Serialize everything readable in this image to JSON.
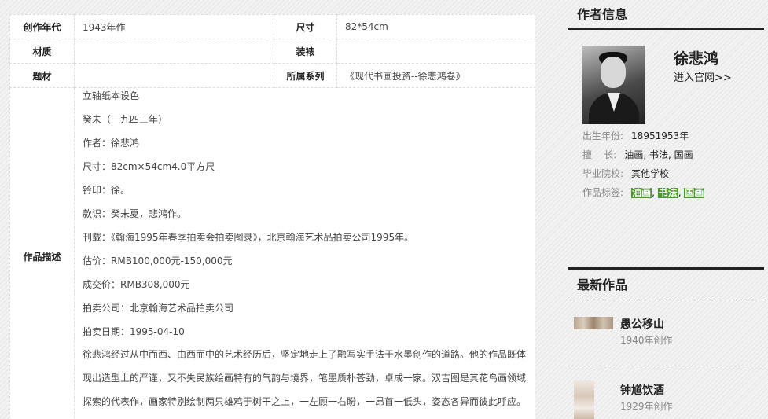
{
  "table": {
    "row1": {
      "label_year": "创作年代",
      "year": "1943年作",
      "label_size": "尺寸",
      "size": "82*54cm"
    },
    "row2": {
      "label_material": "材质",
      "material": "",
      "label_mount": "装裱",
      "mount": ""
    },
    "row3": {
      "label_subject": "题材",
      "subject": "",
      "label_series": "所属系列",
      "series": "《现代书画投资--徐悲鸿卷》"
    },
    "desc_label": "作品描述",
    "desc_lines": [
      "立轴纸本设色",
      "癸未（一九四三年）",
      "作者：徐悲鸿",
      "尺寸：82cm×54cm4.0平方尺",
      "钤印：徐。",
      "款识：癸未夏，悲鸿作。",
      "刊载：《翰海1995年春季拍卖会拍卖图录》，北京翰海艺术品拍卖公司1995年。",
      "估价：RMB100,000元-150,000元",
      "成交价：RMB308,000元",
      "拍卖公司：北京翰海艺术品拍卖公司",
      "拍卖日期：1995-04-10"
    ],
    "desc_para_lines": [
      "徐悲鸿经过从中而西、由西而中的艺术经历后，坚定地走上了融写实手法于水墨创作的道路。他的作品既体",
      "现出造型上的严谨，又不失民族绘画特有的气韵与境界，笔墨质朴苍劲，卓成一家。双吉图是其花鸟画领域",
      "探索的代表作，画家特别绘制两只雄鸡于树干之上，一左顾一右盼，一昂首一低头，姿态各异而彼此呼应。"
    ]
  },
  "author": {
    "heading": "作者信息",
    "name": "徐悲鸿",
    "link": "进入官网>>",
    "birth_label": "出生年份:",
    "birth": "18951953年",
    "skill_label": "擅    长:",
    "skill": "油画, 书法, 国画",
    "school_label": "毕业院校:",
    "school": "其他学校",
    "tags_label": "作品标签:",
    "tags": [
      "油画",
      "书法",
      "国画"
    ],
    "tag_color": "#4a9a2a"
  },
  "works": {
    "heading": "最新作品",
    "items": [
      {
        "title": "愚公移山",
        "year": "1940年创作"
      },
      {
        "title": "钟馗饮酒",
        "year": "1929年创作"
      }
    ]
  }
}
